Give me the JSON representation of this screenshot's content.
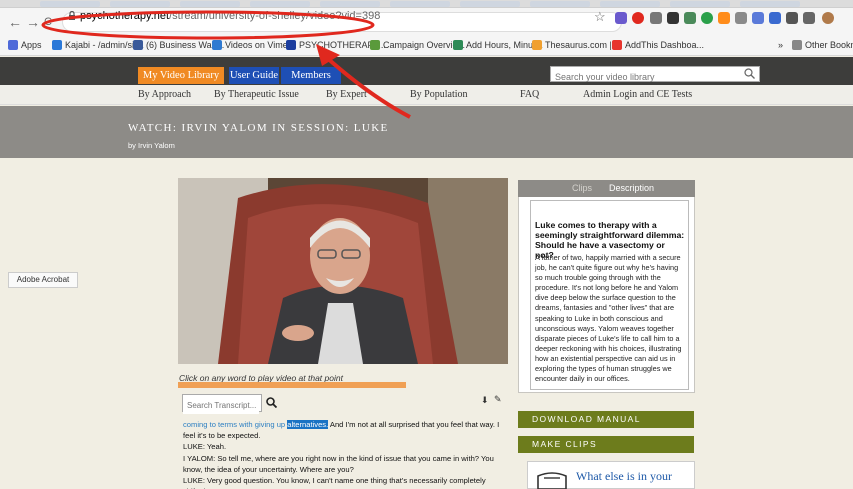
{
  "browser": {
    "url_host": "psychotherapy.net",
    "url_path": "/stream/university-of-shelley/video?vid=398",
    "nav_back": "←",
    "nav_forward": "→",
    "nav_reload": "C",
    "bookmarks": [
      {
        "label": "Apps",
        "color": "#4f6ad9"
      },
      {
        "label": "Kajabi - /admin/sit...",
        "color": "#2a78d8"
      },
      {
        "label": "(6) Business Wan...",
        "color": "#3a5a9a"
      },
      {
        "label": "Videos on Vimeo",
        "color": "#2f7ad1"
      },
      {
        "label": "PSYCHOTHERAPY...",
        "color": "#1c3d9e"
      },
      {
        "label": "Campaign Overvie...",
        "color": "#5a9a3b"
      },
      {
        "label": "Add Hours, Minut...",
        "color": "#2e8b57"
      },
      {
        "label": "Thesaurus.com |...",
        "color": "#f0a030"
      },
      {
        "label": "AddThis Dashboa...",
        "color": "#e7352e"
      },
      {
        "label": "Other Bookmarks",
        "color": "#888888"
      }
    ],
    "more_bookmarks": "»"
  },
  "site": {
    "nav_buttons": {
      "library": "My Video Library",
      "guide": "User Guide",
      "members": "Members Area"
    },
    "search_placeholder": "Search your video library",
    "menu": [
      "By Approach",
      "By Therapeutic Issue",
      "By Expert",
      "By Population",
      "FAQ",
      "Admin Login and CE Tests"
    ],
    "hero_title": "WATCH: IRVIN YALOM IN SESSION: LUKE",
    "hero_by": "by Irvin Yalom",
    "adobe_button": "Adobe Acrobat"
  },
  "video": {
    "hint": "Click on any word to play video at that point",
    "progress": 0.69
  },
  "transcript": {
    "search_placeholder": "Search Transcript...",
    "lines": {
      "l1_blue": "coming to terms with giving up ",
      "l1_hl": "alternatives.",
      "l1_rest": " And I'm not at all surprised that you feel that way. I",
      "l2": "feel it's to be expected.",
      "l3": "LUKE: Yeah.",
      "l4": "I YALOM: So tell me, where are you right now in the kind of issue that you came in with? You",
      "l5": "know, the idea of your uncertainty. Where are you?",
      "l6": "LUKE: Very good question. You know, I can't name one thing that's necessarily completely shifted,"
    }
  },
  "panel": {
    "tabs": {
      "clips": "Clips",
      "description": "Description"
    },
    "title": "Luke comes to therapy with a seemingly straightforward dilemma: Should he have a vasectomy or not?",
    "body": "A father of two, happily married with a secure job, he can't quite figure out why he's having so much trouble going through with the procedure. It's not long before he and Yalom dive deep below the surface question to the dreams, fantasies and \"other lives\" that are speaking to Luke in both conscious and unconscious ways. Yalom weaves together disparate pieces of Luke's life to call him to a deeper reckoning with his choices, illustrating how an existential perspective can aid us in exploring the types of human struggles we encounter daily in our offices.",
    "download_manual": "DOWNLOAD MANUAL",
    "make_clips": "MAKE CLIPS",
    "what_else": "What else is in your"
  },
  "colors": {
    "orange": "#f08a23",
    "blue": "#1e4fb5",
    "olive": "#6d7c1c",
    "annotation_red": "#e0281e"
  }
}
